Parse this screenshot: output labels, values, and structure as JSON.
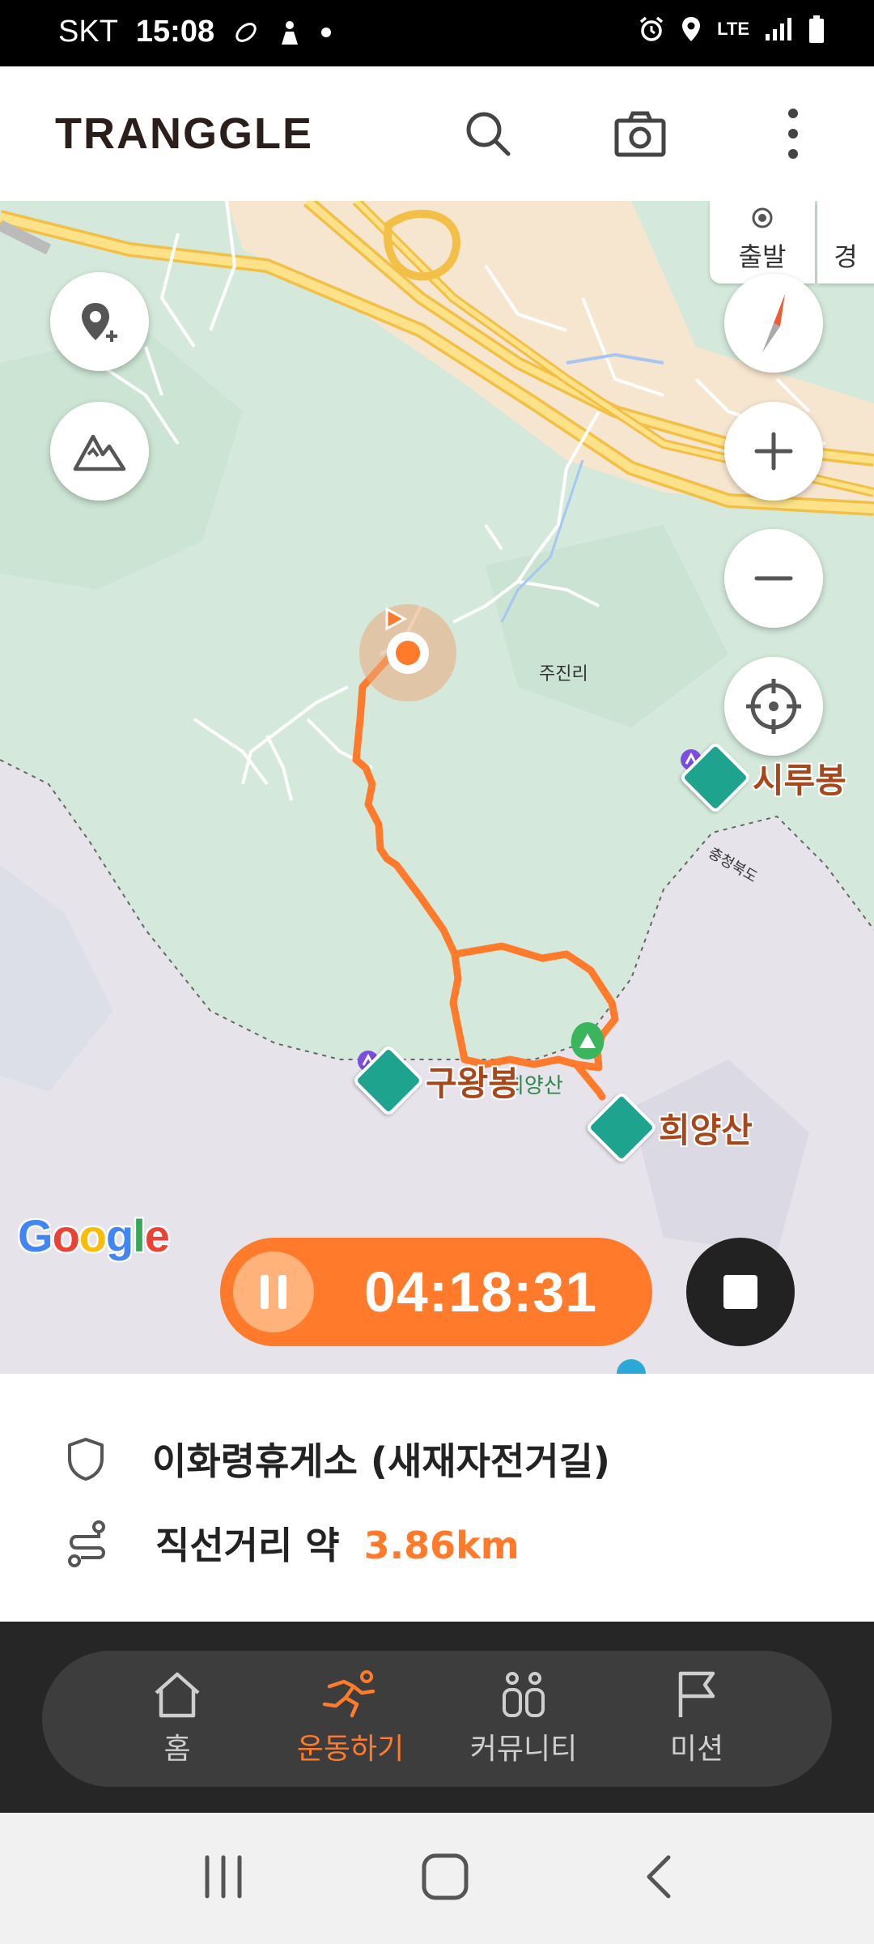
{
  "status_bar": {
    "carrier": "SKT",
    "time": "15:08",
    "network": "LTE"
  },
  "header": {
    "logo": "TRANGGLE",
    "icons": [
      "search-icon",
      "camera-icon",
      "more-vertical-icon"
    ]
  },
  "map": {
    "tabs": {
      "start": "출발",
      "route_partial": "경"
    },
    "labels": {
      "village": "주진리",
      "province": "충청북도",
      "trail_marker": "희양산"
    },
    "peaks": [
      {
        "name": "시루봉"
      },
      {
        "name": "구왕봉"
      },
      {
        "name": "희양산"
      }
    ],
    "google": "Google",
    "colors": {
      "route": "#ff7a2a",
      "peak": "#1ea38f",
      "forest": "#d6eadc"
    }
  },
  "tracking": {
    "elapsed": "04:18:31"
  },
  "info": {
    "location": "이화령휴게소 (새재자전거길)",
    "distance_label": "직선거리 약",
    "distance_value": "3.86km"
  },
  "bottom_nav": {
    "items": [
      {
        "label": "홈",
        "icon": "home-icon",
        "active": false
      },
      {
        "label": "운동하기",
        "icon": "running-icon",
        "active": true
      },
      {
        "label": "커뮤니티",
        "icon": "community-icon",
        "active": false
      },
      {
        "label": "미션",
        "icon": "flag-icon",
        "active": false
      }
    ],
    "active_color": "#ff7a2a"
  }
}
